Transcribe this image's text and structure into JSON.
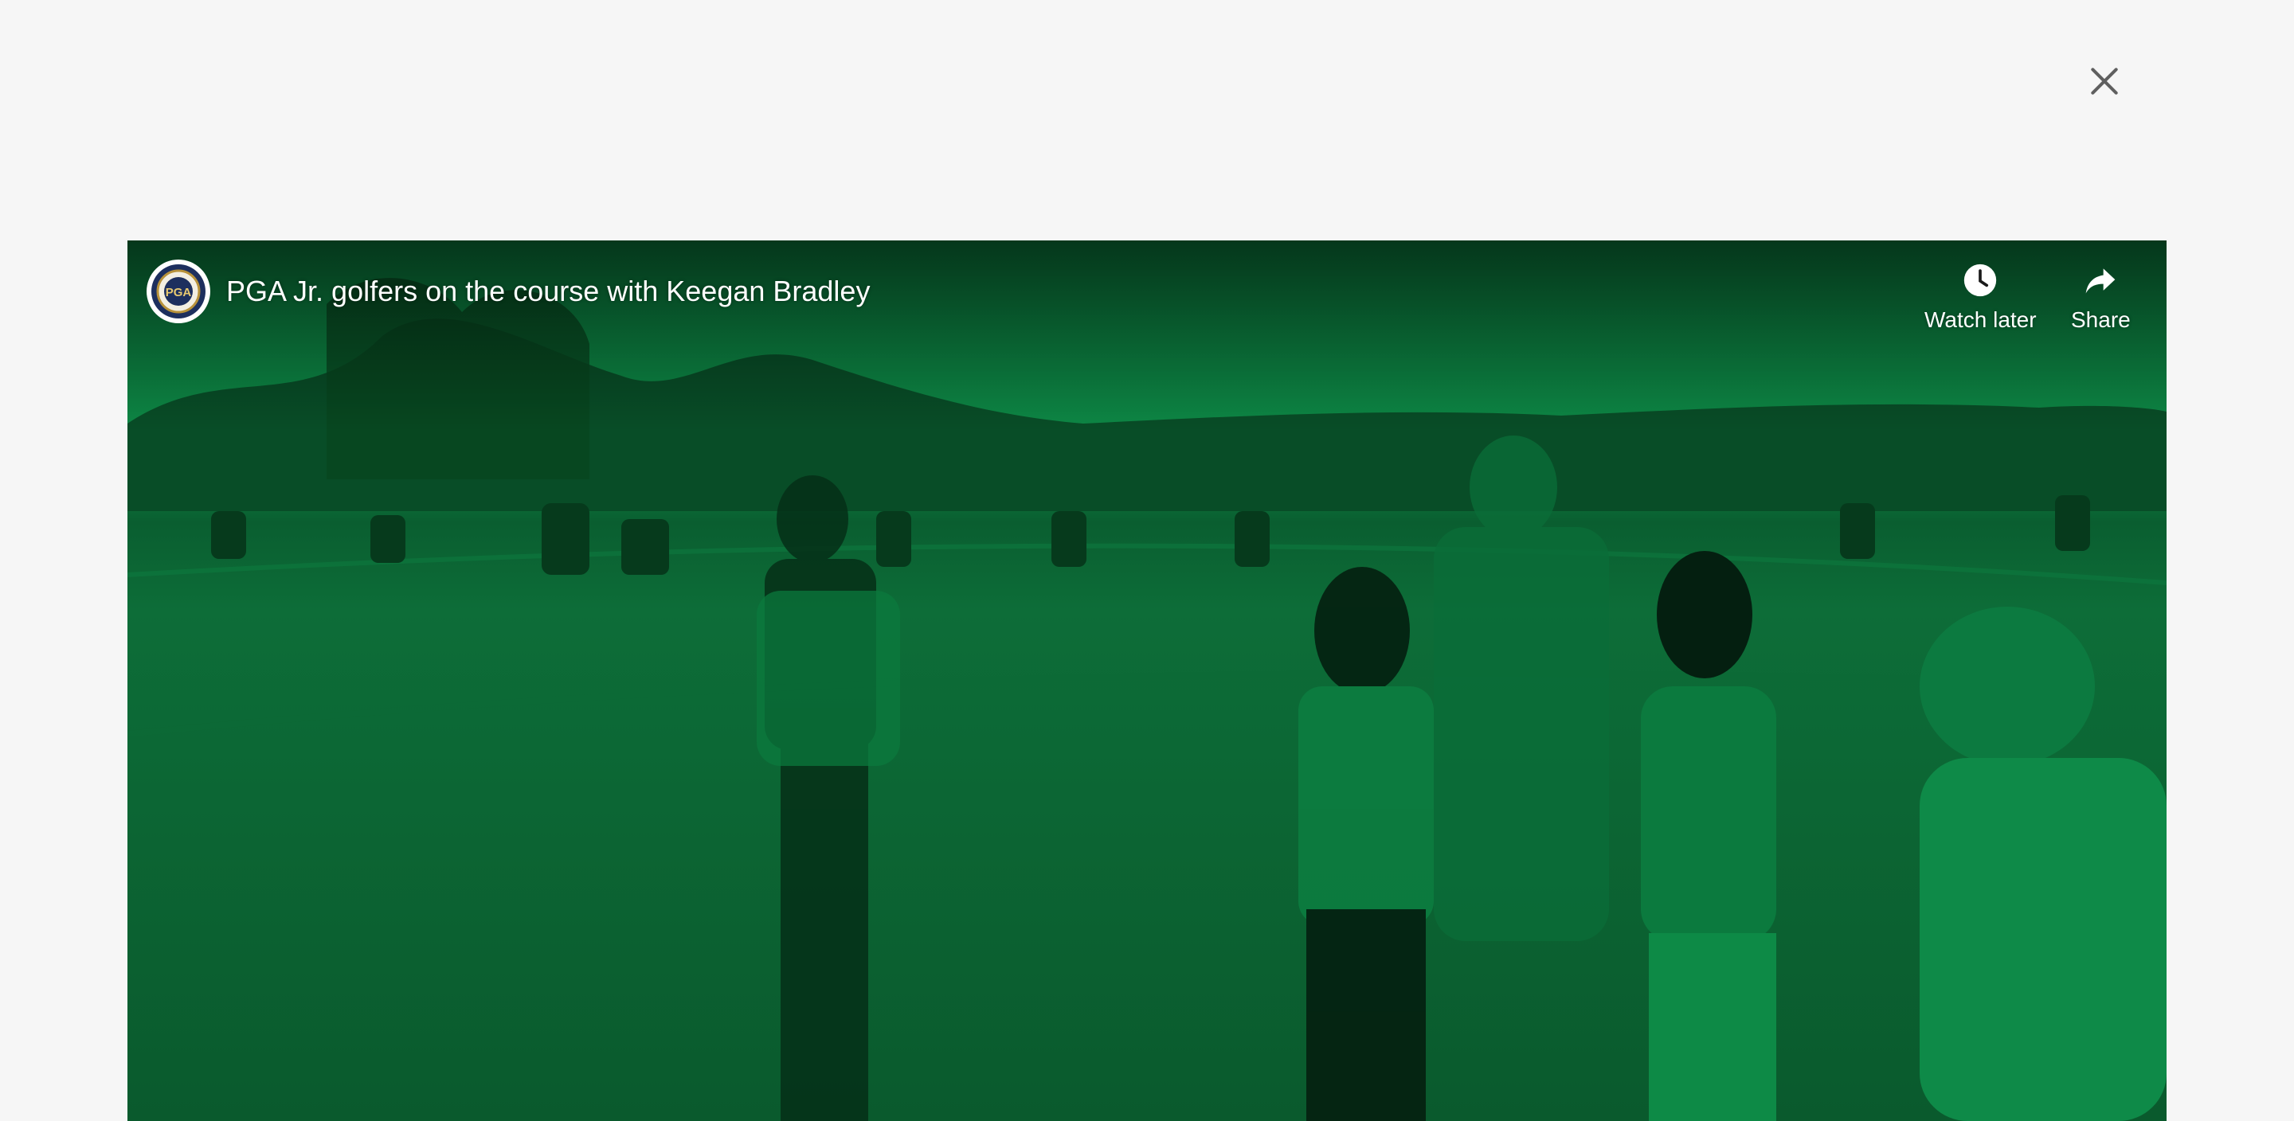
{
  "modal": {
    "close_icon": "close-icon"
  },
  "video": {
    "title": "PGA Jr. golfers on the course with Keegan Bradley",
    "channel": {
      "logo_text": "PGA",
      "icon": "channel-logo-icon"
    },
    "actions": {
      "watch_later": {
        "label": "Watch later",
        "icon": "clock-icon"
      },
      "share": {
        "label": "Share",
        "icon": "share-arrow-icon"
      }
    },
    "tint_color": "#0b8a46"
  }
}
